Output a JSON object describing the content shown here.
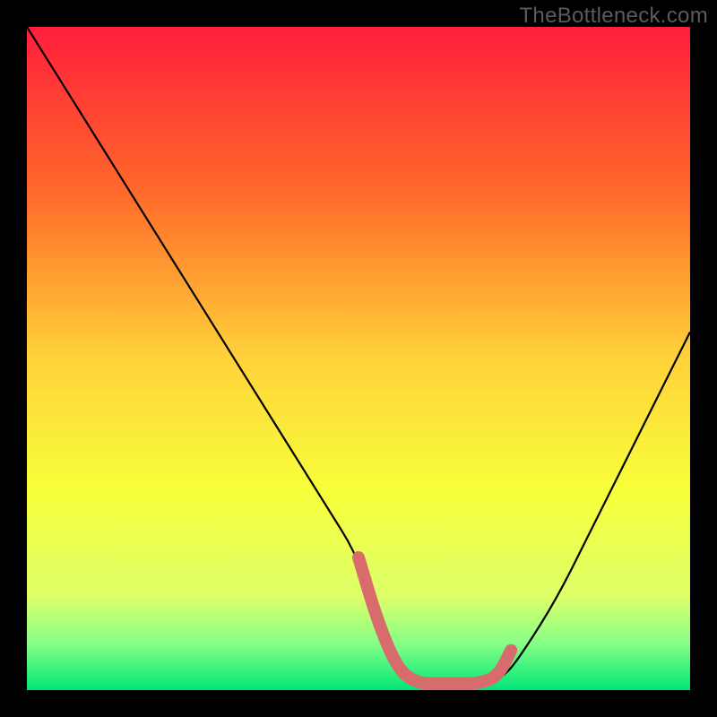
{
  "watermark": "TheBottleneck.com",
  "chart_data": {
    "type": "line",
    "title": "",
    "xlabel": "",
    "ylabel": "",
    "xlim": [
      0,
      100
    ],
    "ylim": [
      0,
      100
    ],
    "series": [
      {
        "name": "curve",
        "color": "#000000",
        "x": [
          0,
          5,
          10,
          15,
          20,
          25,
          30,
          35,
          40,
          45,
          50,
          52,
          55,
          58,
          60,
          63,
          66,
          69,
          72,
          75,
          80,
          85,
          90,
          95,
          100
        ],
        "values": [
          100,
          92,
          84,
          76,
          68,
          60,
          52,
          44,
          36,
          28,
          20,
          12,
          4,
          1,
          1,
          1,
          1,
          1,
          2,
          6,
          14,
          24,
          34,
          44,
          54
        ]
      },
      {
        "name": "highlight",
        "color": "#d86c6c",
        "x": [
          50,
          53,
          56,
          59,
          62,
          65,
          68,
          71,
          73
        ],
        "values": [
          20,
          10,
          3,
          1,
          1,
          1,
          1,
          2,
          6
        ]
      }
    ],
    "gradient_stops": [
      {
        "offset": 0.0,
        "color": "#ff1e3c"
      },
      {
        "offset": 0.25,
        "color": "#ff6a2a"
      },
      {
        "offset": 0.5,
        "color": "#ffd23a"
      },
      {
        "offset": 0.7,
        "color": "#f7ff3a"
      },
      {
        "offset": 0.86,
        "color": "#dcff6a"
      },
      {
        "offset": 0.93,
        "color": "#86ff86"
      },
      {
        "offset": 1.0,
        "color": "#00e676"
      }
    ]
  }
}
